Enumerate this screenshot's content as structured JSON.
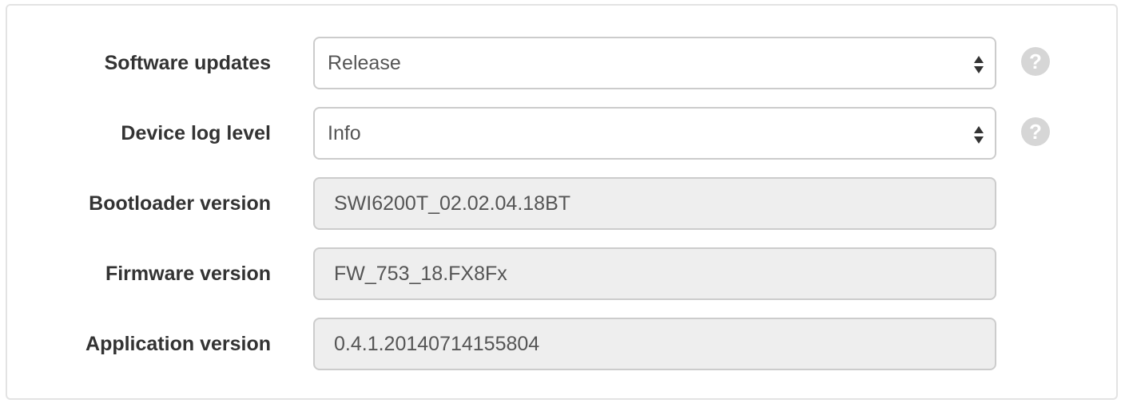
{
  "settings": {
    "software_updates": {
      "label": "Software updates",
      "value": "Release",
      "help_icon": "question-circle-icon"
    },
    "device_log_level": {
      "label": "Device log level",
      "value": "Info",
      "help_icon": "question-circle-icon"
    },
    "bootloader_version": {
      "label": "Bootloader version",
      "value": "SWI6200T_02.02.04.18BT"
    },
    "firmware_version": {
      "label": "Firmware version",
      "value": "FW_753_18.FX8Fx"
    },
    "application_version": {
      "label": "Application version",
      "value": "0.4.1.20140714155804"
    }
  },
  "icons": {
    "help_glyph": "?",
    "select_arrows": "select-arrows-icon"
  },
  "colors": {
    "label_text": "#333333",
    "field_text": "#555555",
    "readonly_background": "#eeeeee",
    "border": "#cccccc",
    "help_icon": "#d6d6d6"
  }
}
